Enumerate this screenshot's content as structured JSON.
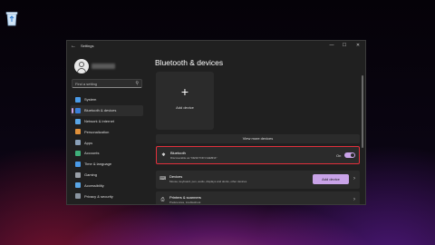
{
  "window": {
    "title": "Settings",
    "controls": {
      "minimize": "—",
      "maximize": "☐",
      "close": "✕"
    }
  },
  "accent_color": "#c9a3e8",
  "highlight_color": "#e2303c",
  "sidebar": {
    "search": {
      "placeholder": "Find a setting"
    },
    "items": [
      {
        "label": "System",
        "icon": "monitor-icon",
        "color": "#4a9be8"
      },
      {
        "label": "Bluetooth & devices",
        "icon": "bluetooth-icon",
        "color": "#3a7fd9",
        "active": true
      },
      {
        "label": "Network & internet",
        "icon": "wifi-icon",
        "color": "#5aa6e6"
      },
      {
        "label": "Personalization",
        "icon": "brush-icon",
        "color": "#e0903a"
      },
      {
        "label": "Apps",
        "icon": "apps-icon",
        "color": "#8aa0b8"
      },
      {
        "label": "Accounts",
        "icon": "person-icon",
        "color": "#3fb07a"
      },
      {
        "label": "Time & language",
        "icon": "globe-icon",
        "color": "#4a9be8"
      },
      {
        "label": "Gaming",
        "icon": "gamepad-icon",
        "color": "#9aa0a8"
      },
      {
        "label": "Accessibility",
        "icon": "accessibility-icon",
        "color": "#5aa6e6"
      },
      {
        "label": "Privacy & security",
        "icon": "shield-icon",
        "color": "#8a94a0"
      }
    ]
  },
  "main": {
    "title": "Bluetooth & devices",
    "add_tile": {
      "plus": "+",
      "label": "Add device"
    },
    "view_more": "View more devices",
    "bluetooth": {
      "title": "Bluetooth",
      "subtitle": "Discoverable as \"DESKTOP-NHE8N4\"",
      "state": "On",
      "enabled": true
    },
    "devices": {
      "title": "Devices",
      "subtitle": "Mouse, keyboard, pen, audio, displays and docks, other devices",
      "button": "Add device",
      "chevron": "›"
    },
    "printers": {
      "title": "Printers & scanners",
      "subtitle": "Preferences, troubleshoot",
      "chevron": "›"
    }
  }
}
